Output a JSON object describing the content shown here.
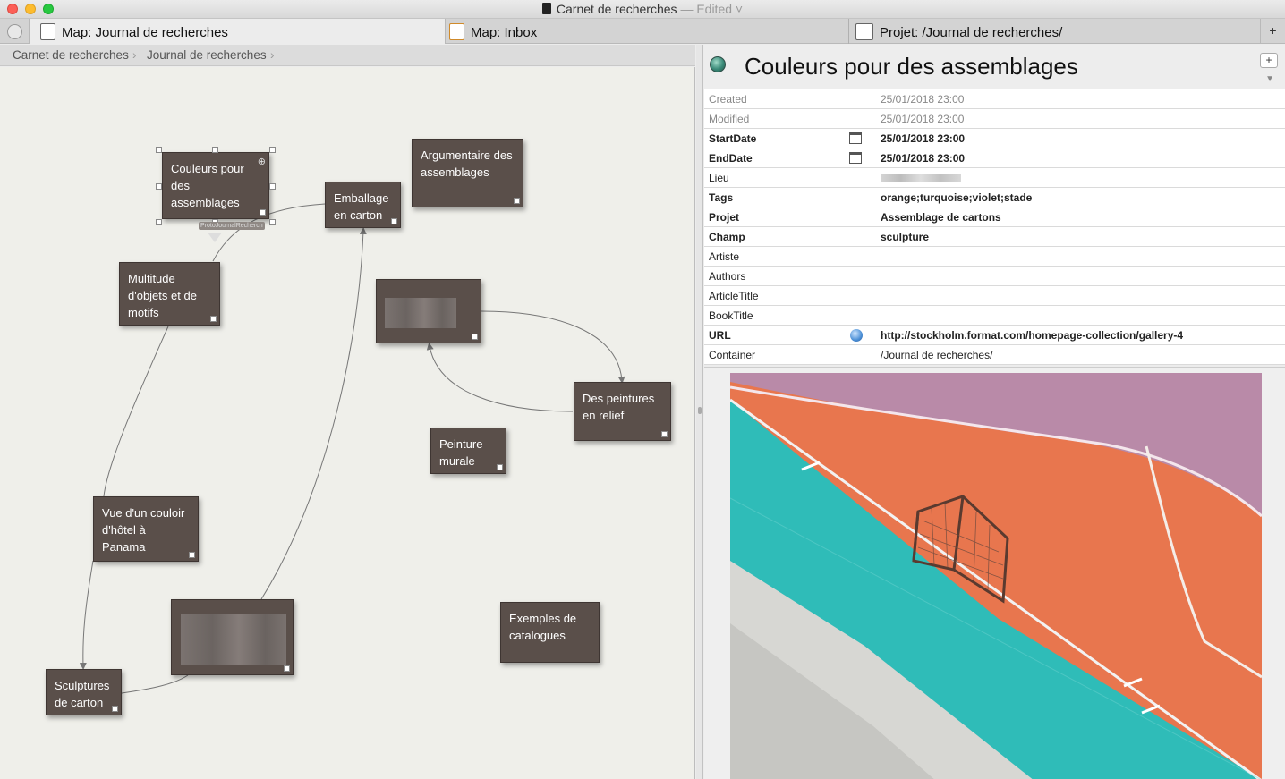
{
  "window": {
    "title": "Carnet de recherches",
    "edited": "— Edited ˅"
  },
  "tabs": [
    {
      "label": "Map: Journal de recherches"
    },
    {
      "label": "Map: Inbox"
    },
    {
      "label": "Projet: /Journal de recherches/"
    }
  ],
  "tab_add": "+",
  "breadcrumb": [
    "Carnet de recherches",
    "Journal de recherches"
  ],
  "map": {
    "notes": {
      "couleurs": "Couleurs pour des assemblages",
      "argumentaire": "Argumentaire des assemblages",
      "emballage": "Emballage en carton",
      "multitude": "Multitude d'objets et de motifs",
      "peintures": "Des peintures en relief",
      "murale": "Peinture murale",
      "couloir": "Vue d'un couloir d'hôtel à Panama",
      "exemples": "Exemples de catalogues",
      "sculptures": "Sculptures de carton"
    },
    "prototype_tag": "ProtoJournalRecherch"
  },
  "inspector": {
    "title": "Couleurs pour des assemblages",
    "add_label": "+",
    "attributes": [
      {
        "key": "Created",
        "value": "25/01/2018 23:00"
      },
      {
        "key": "Modified",
        "value": "25/01/2018 23:00"
      },
      {
        "key": "StartDate",
        "value": "25/01/2018 23:00"
      },
      {
        "key": "EndDate",
        "value": "25/01/2018 23:00"
      },
      {
        "key": "Lieu",
        "value": ""
      },
      {
        "key": "Tags",
        "value": "orange;turquoise;violet;stade"
      },
      {
        "key": "Projet",
        "value": "Assemblage de cartons"
      },
      {
        "key": "Champ",
        "value": "sculpture"
      },
      {
        "key": "Artiste",
        "value": ""
      },
      {
        "key": "Authors",
        "value": ""
      },
      {
        "key": "ArticleTitle",
        "value": ""
      },
      {
        "key": "BookTitle",
        "value": ""
      },
      {
        "key": "URL",
        "value": "http://stockholm.format.com/homepage-collection/gallery-4"
      },
      {
        "key": "Container",
        "value": "/Journal de recherches/"
      }
    ]
  },
  "colors": {
    "note_bg": "#5a4f4a",
    "map_bg": "#efefea",
    "court_orange": "#e8764e",
    "court_teal": "#2fbcb8",
    "court_purple": "#b98aa8"
  }
}
